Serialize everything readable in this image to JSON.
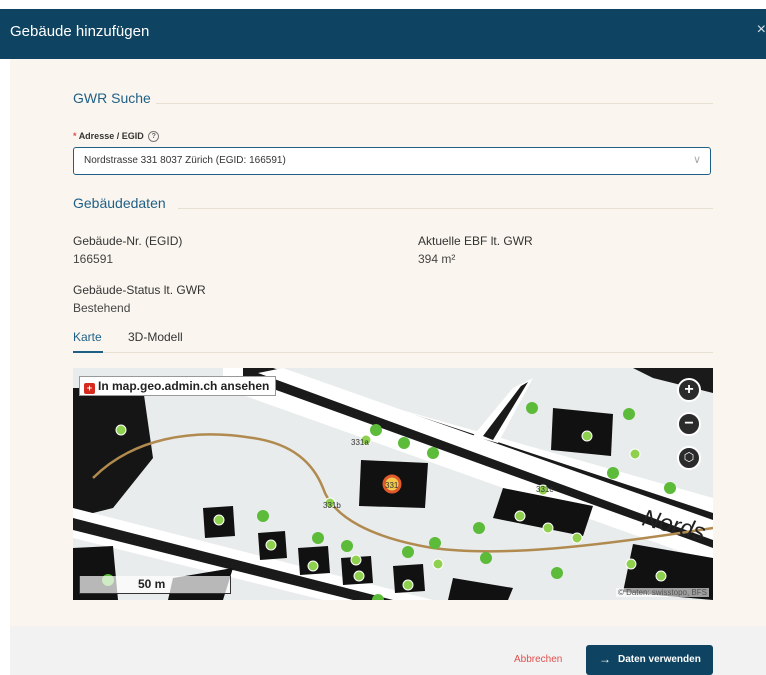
{
  "dialog": {
    "title": "Gebäude hinzufügen",
    "close_icon": "close-icon"
  },
  "gwr": {
    "section_title": "GWR Suche",
    "field_label": "Adresse / EGID",
    "required_mark": "*",
    "help_icon": "?",
    "selected_value": "Nordstrasse 331 8037 Zürich (EGID: 166591)"
  },
  "building": {
    "section_title": "Gebäudedaten",
    "fields": [
      {
        "label": "Gebäude-Nr. (EGID)",
        "value": "166591"
      },
      {
        "label": "Aktuelle EBF lt. GWR",
        "value": "394 m²"
      },
      {
        "label": "Gebäude-Status lt. GWR",
        "value": "Bestehend"
      }
    ]
  },
  "tabs": [
    {
      "label": "Karte",
      "active": true
    },
    {
      "label": "3D-Modell",
      "active": false
    }
  ],
  "map": {
    "link_label": "In map.geo.admin.ch ansehen",
    "zoom_in": "+",
    "zoom_out": "−",
    "scale_label": "50 m",
    "attribution": "© Daten: swisstopo, BFS",
    "street_label": "Nords",
    "house_numbers": [
      "331a",
      "331b",
      "331c",
      "331"
    ]
  },
  "footer": {
    "cancel_label": "Abbrechen",
    "confirm_label": "Daten verwenden",
    "confirm_icon": "→"
  },
  "colors": {
    "header": "#0e4461",
    "accent": "#1f5f86",
    "danger": "#e05050"
  }
}
